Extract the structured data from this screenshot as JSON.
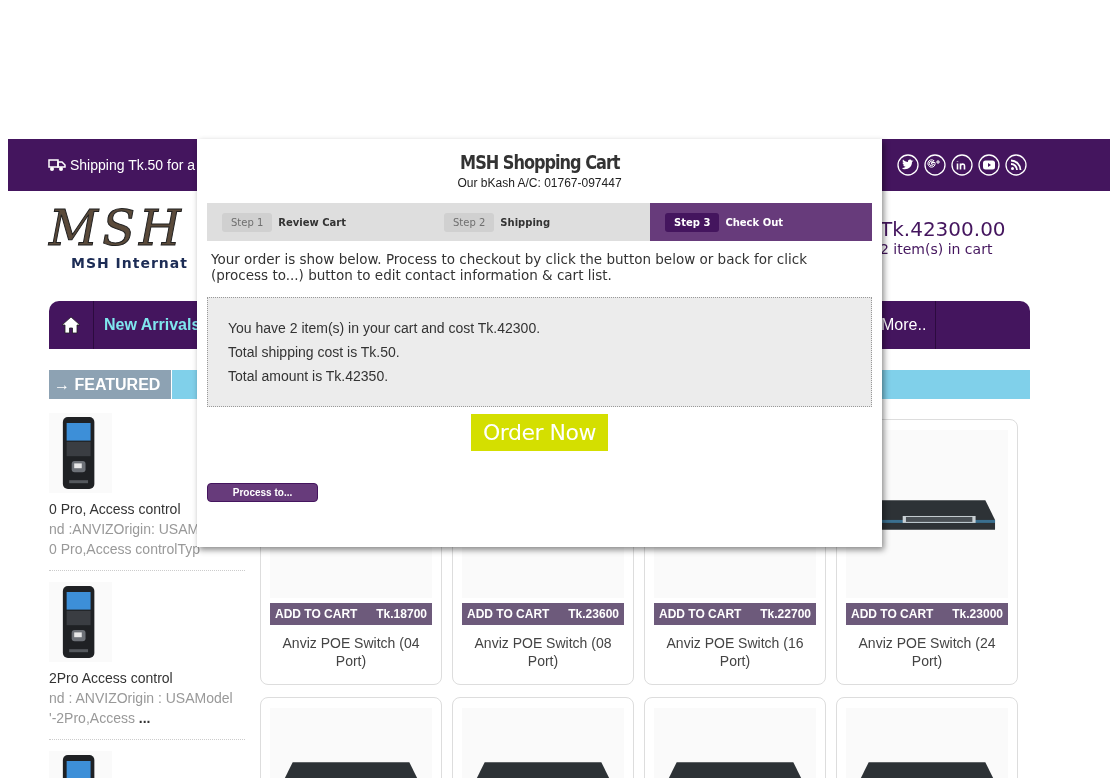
{
  "top_bar": {
    "shipping_text": "Shipping Tk.50 for a"
  },
  "header": {
    "logo": "MSH",
    "logo_subtitle": "MSH Internat",
    "cart_total": "Tk.42300.00",
    "cart_count": "2 item(s) in cart"
  },
  "nav": {
    "items": [
      {
        "label": "New Arrivals"
      },
      {
        "label": "More.."
      }
    ]
  },
  "featured": {
    "title": "→ FEATURED",
    "items": [
      {
        "kind": "picture",
        "name": "0 Pro, Access control",
        "lines": [
          "nd :ANVIZOrigin: USAM",
          "0 Pro,Access controlTyp"
        ]
      },
      {
        "kind": "picture",
        "name": "2Pro Access control",
        "lines": [
          "nd : ANVIZOrigin : USAModel",
          "'-2Pro,Access **...**"
        ]
      },
      {
        "kind": "picture"
      }
    ]
  },
  "products": [
    {
      "button": "ADD TO CART",
      "price": "Tk.18700",
      "name": "Anviz POE Switch (04 Port)"
    },
    {
      "button": "ADD TO CART",
      "price": "Tk.23600",
      "name": "Anviz POE Switch (08 Port)"
    },
    {
      "button": "ADD TO CART",
      "price": "Tk.22700",
      "name": "Anviz POE Switch (16 Port)"
    },
    {
      "kind": "picture",
      "button": "ADD TO CART",
      "price": "Tk.23000",
      "name": "Anviz POE Switch (24 Port)"
    },
    {
      "kind": "picture"
    },
    {
      "kind": "picture"
    },
    {
      "kind": "picture"
    },
    {
      "kind": "picture"
    }
  ],
  "modal": {
    "title": "MSH Shopping Cart",
    "subtitle": "Our bKash A/C: 01767-097447",
    "steps": [
      {
        "number": "Step 1",
        "label": "Review Cart",
        "selected": false
      },
      {
        "number": "Step 2",
        "label": "Shipping",
        "selected": false
      },
      {
        "number": "Step 3",
        "label": "Check Out",
        "selected": true
      }
    ],
    "description": "Your order is show below. Process to checkout by click the button below or back for click (process to...) button to edit contact information & cart list.",
    "summary_lines": [
      "You have 2 item(s) in your cart and cost Tk.42300.",
      "Total shipping cost is Tk.50.",
      "Total amount is Tk.42350."
    ],
    "order_button": "Order Now",
    "process_button": "Process to..."
  }
}
